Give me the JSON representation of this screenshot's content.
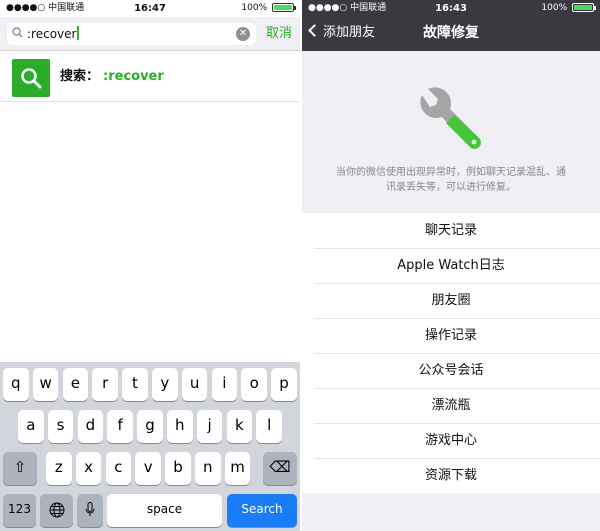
{
  "left": {
    "status": {
      "carrier": "●●●●○ 中国联通",
      "time": "16:47",
      "battery": "100%",
      "battery_level": 1.0
    },
    "search": {
      "query": ":recover",
      "cancel": "取消"
    },
    "result": {
      "prefix": "搜索：",
      "query": ":recover"
    },
    "keyboard": {
      "row1": [
        "q",
        "w",
        "e",
        "r",
        "t",
        "y",
        "u",
        "i",
        "o",
        "p"
      ],
      "row2": [
        "a",
        "s",
        "d",
        "f",
        "g",
        "h",
        "j",
        "k",
        "l"
      ],
      "row3": [
        "z",
        "x",
        "c",
        "v",
        "b",
        "n",
        "m"
      ],
      "numbers": "123",
      "space": "space",
      "search": "Search",
      "shift_glyph": "⇧",
      "delete_glyph": "⌫"
    }
  },
  "right": {
    "status": {
      "carrier": "●●●●○ 中国联通",
      "time": "16:43",
      "battery": "100%",
      "battery_level": 1.0
    },
    "nav": {
      "back": "添加朋友",
      "title": "故障修复"
    },
    "description": "当你的微信使用出现异常时，例如聊天记录混乱、通讯录丢失等，可以进行修复。",
    "menu": [
      "聊天记录",
      "Apple Watch日志",
      "朋友圈",
      "操作记录",
      "公众号会话",
      "漂流瓶",
      "游戏中心",
      "资源下载"
    ]
  },
  "colors": {
    "wechat_green": "#2aae2a",
    "nav_dark": "#393a3f",
    "ios_blue": "#1a7cf7"
  }
}
